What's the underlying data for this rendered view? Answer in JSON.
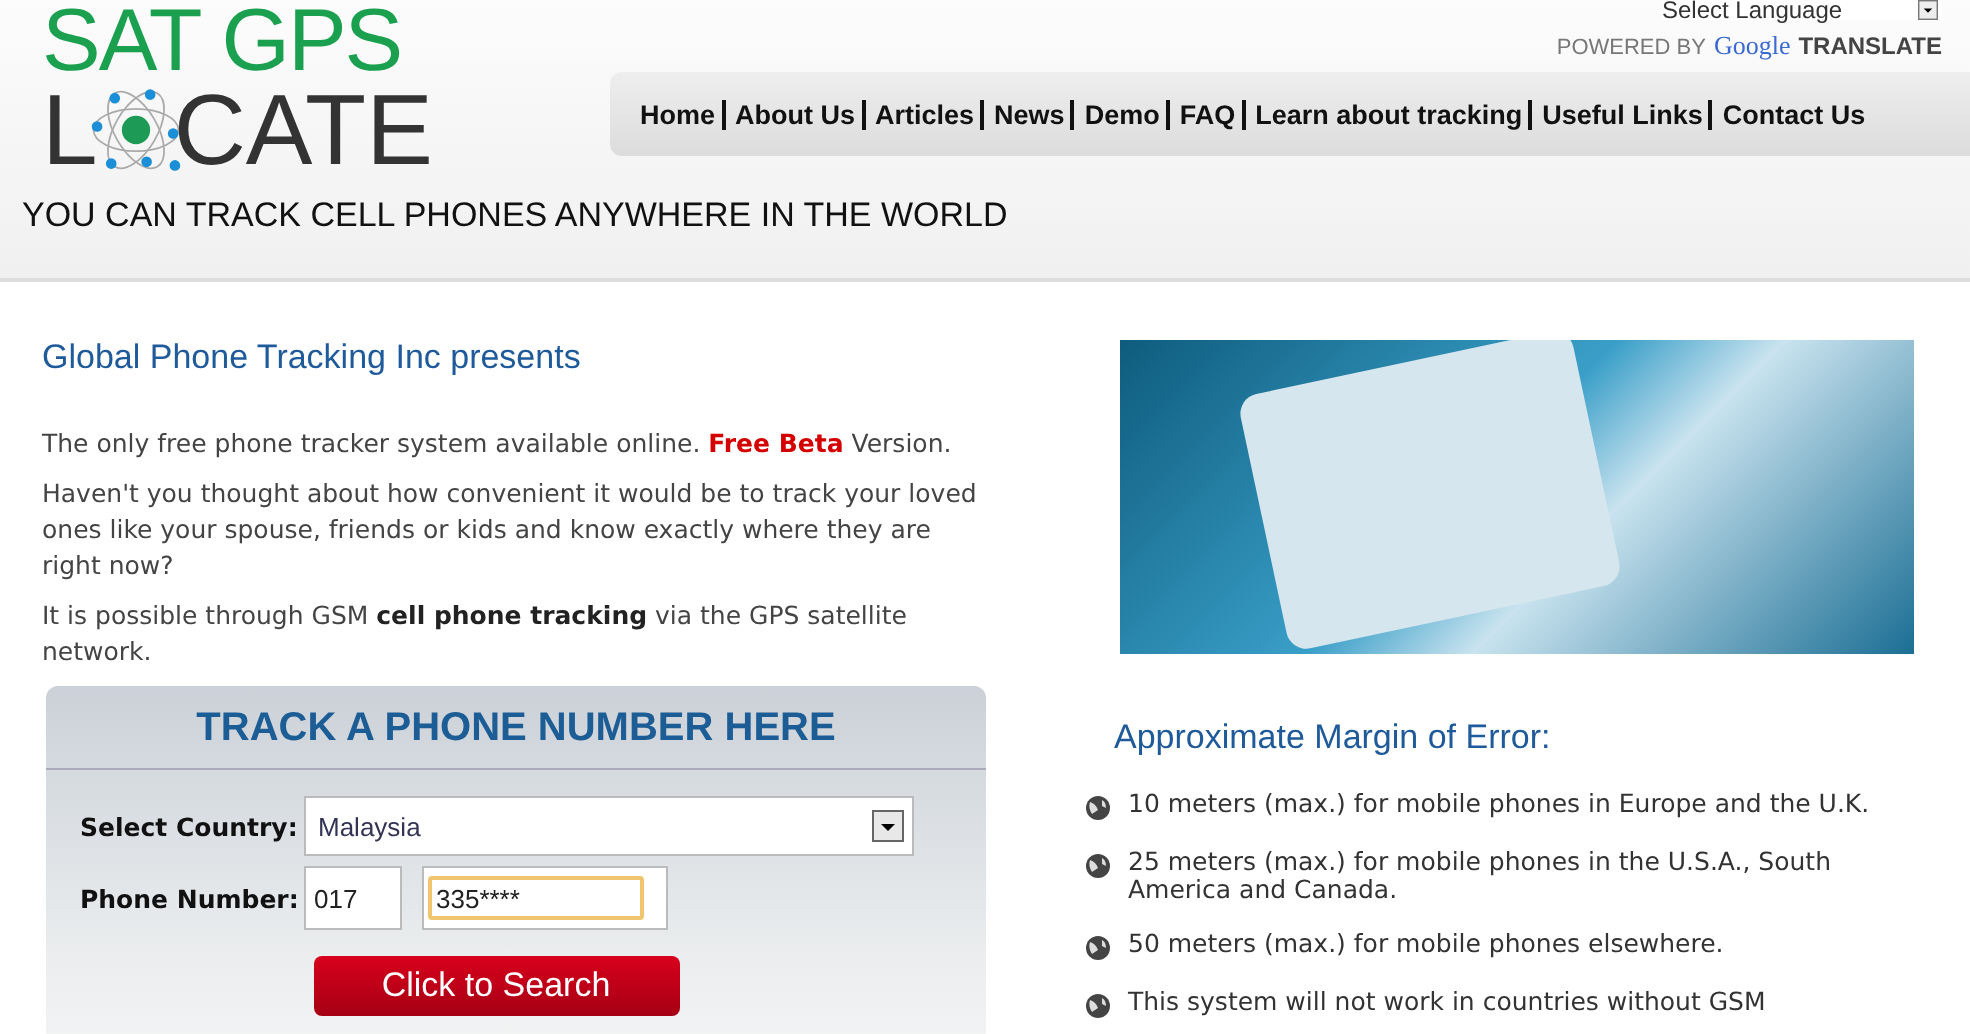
{
  "logo": {
    "line1": "SAT GPS",
    "line2_start": "L",
    "line2_end": "CATE"
  },
  "language": {
    "placeholder": "Select Language",
    "powered_by": "POWERED BY",
    "brand": "Google",
    "translate": "TRANSLATE"
  },
  "nav": [
    {
      "label": "Home"
    },
    {
      "label": "About Us"
    },
    {
      "label": "Articles"
    },
    {
      "label": "News"
    },
    {
      "label": "Demo"
    },
    {
      "label": "FAQ"
    },
    {
      "label": "Learn about tracking"
    },
    {
      "label": "Useful Links"
    },
    {
      "label": "Contact Us"
    }
  ],
  "tagline": "YOU CAN TRACK CELL PHONES ANYWHERE IN THE WORLD",
  "intro": {
    "title": "Global Phone Tracking Inc presents",
    "paragraphs": [
      "The only free phone tracker system available online. **Free Beta** Version.",
      "Haven't you thought about how convenient it would be to track your loved ones like your spouse, friends or kids and know exactly where they are right now?",
      "It is possible through GSM **cell phone tracking** via the GPS satellite network."
    ]
  },
  "form": {
    "title": "TRACK A PHONE NUMBER HERE",
    "country_label": "Select Country:",
    "country": "Malaysia",
    "phone_label": "Phone Number:",
    "prefix": "017",
    "number": "335****",
    "button": "Click to Search"
  },
  "margin": {
    "title": "Approximate Margin of Error:",
    "items": [
      "10 meters (max.) for mobile phones in Europe and the U.K.",
      "25 meters (max.) for mobile phones in the U.S.A., South America and Canada.",
      "50 meters (max.) for mobile phones elsewhere.",
      "This system will not work in countries without GSM"
    ]
  }
}
